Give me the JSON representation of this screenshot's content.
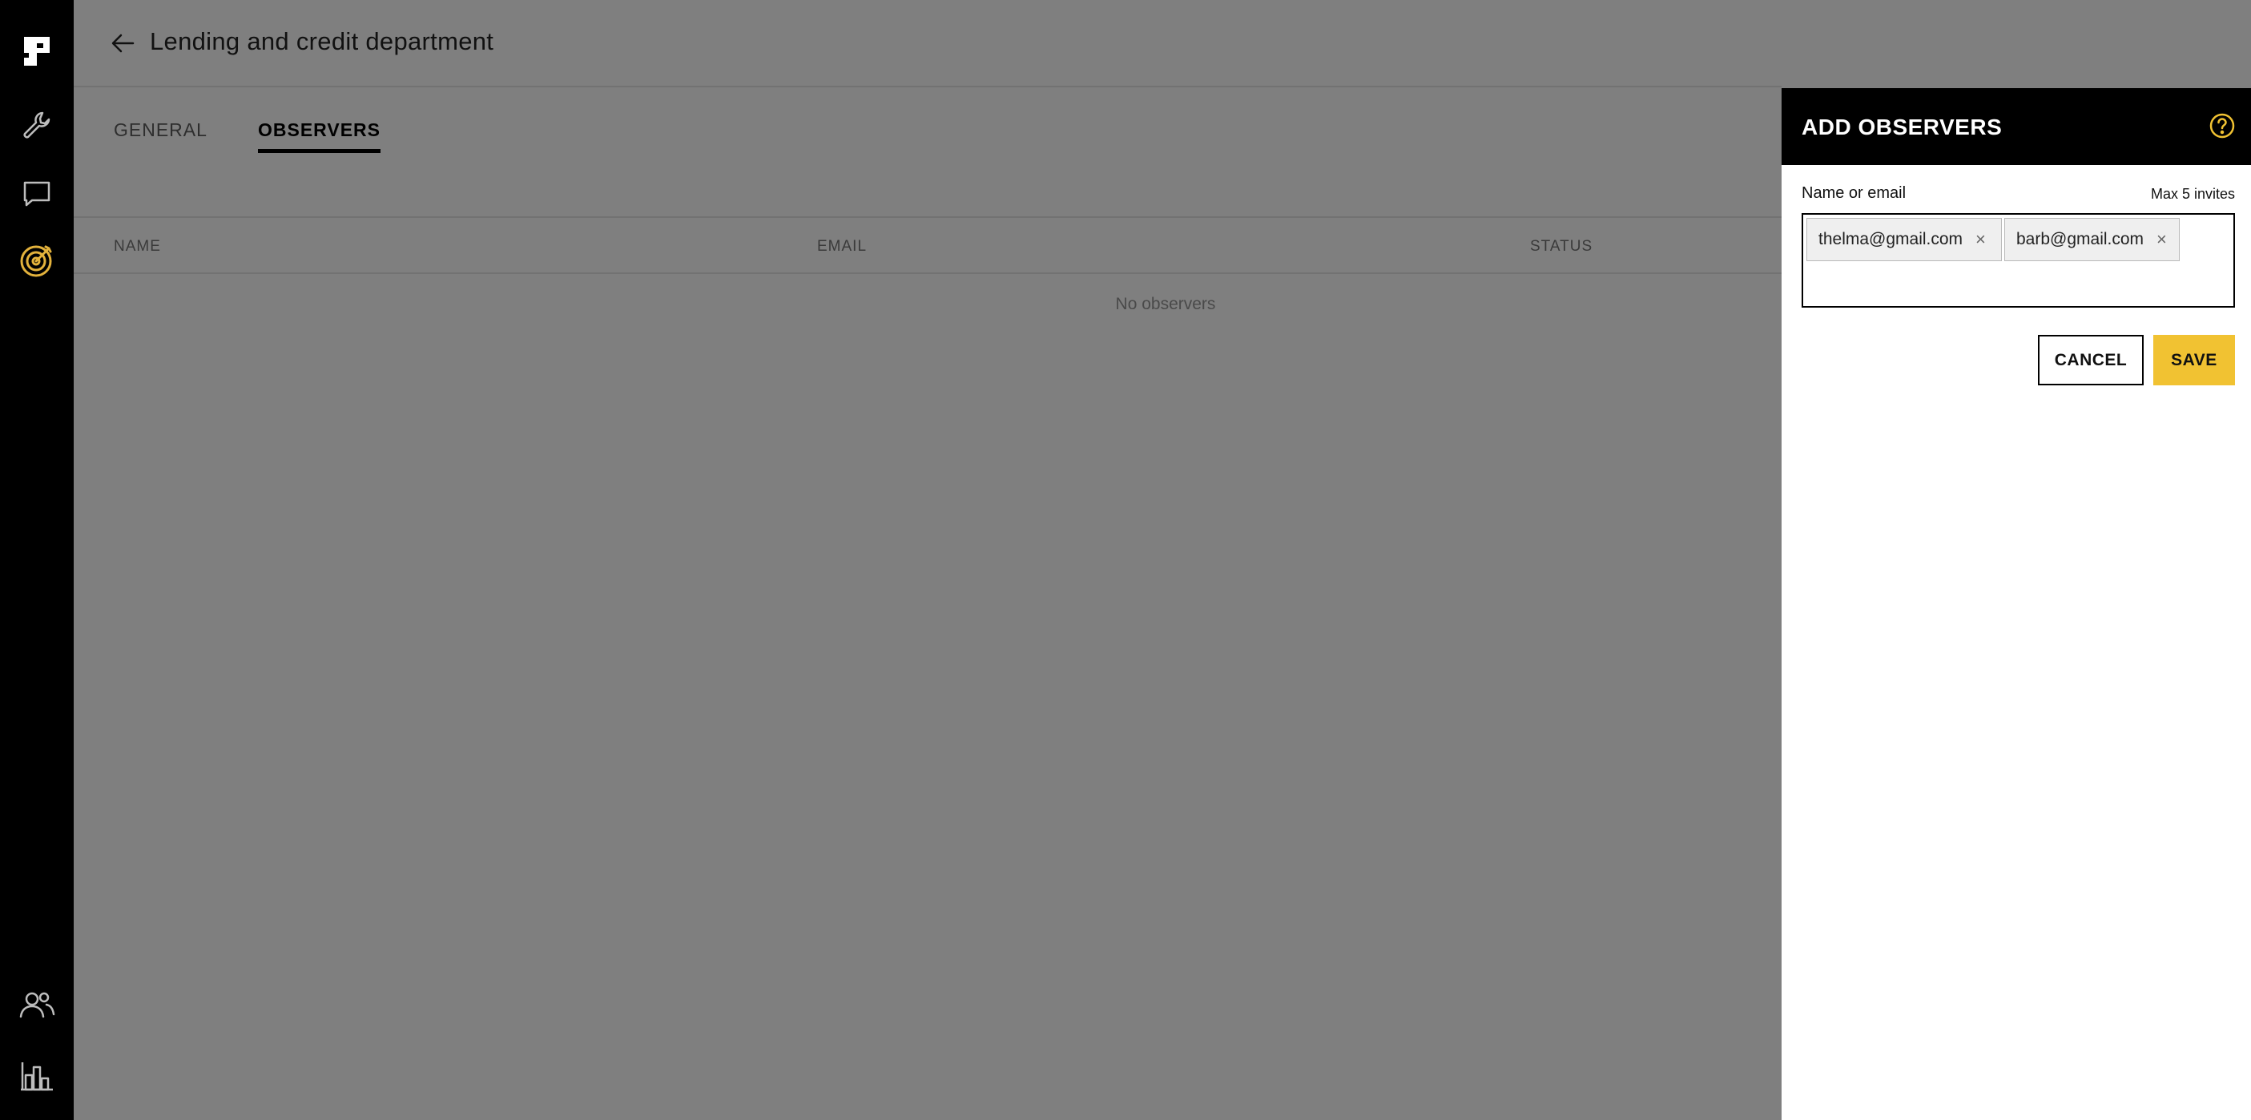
{
  "colors": {
    "sidebar_bg": "#000000",
    "accent": "#f1c232",
    "overlay": "#7f7f7f"
  },
  "sidebar": {
    "items": [
      {
        "name": "app-logo",
        "icon": "logo-icon"
      },
      {
        "name": "tools",
        "icon": "wrench-icon"
      },
      {
        "name": "messages",
        "icon": "chat-icon"
      },
      {
        "name": "goals",
        "icon": "target-icon",
        "active": true
      },
      {
        "name": "people",
        "icon": "people-icon"
      },
      {
        "name": "analytics",
        "icon": "bar-chart-icon"
      }
    ]
  },
  "header": {
    "title": "Lending and credit department"
  },
  "tabs": [
    {
      "label": "GENERAL",
      "active": false
    },
    {
      "label": "OBSERVERS",
      "active": true
    }
  ],
  "table": {
    "columns": [
      "NAME",
      "EMAIL",
      "STATUS"
    ],
    "empty_message": "No observers"
  },
  "panel": {
    "title": "ADD OBSERVERS",
    "field_label": "Name or email",
    "field_hint": "Max 5 invites",
    "tags": [
      "thelma@gmail.com",
      "barb@gmail.com"
    ],
    "cancel_label": "CANCEL",
    "save_label": "SAVE"
  }
}
